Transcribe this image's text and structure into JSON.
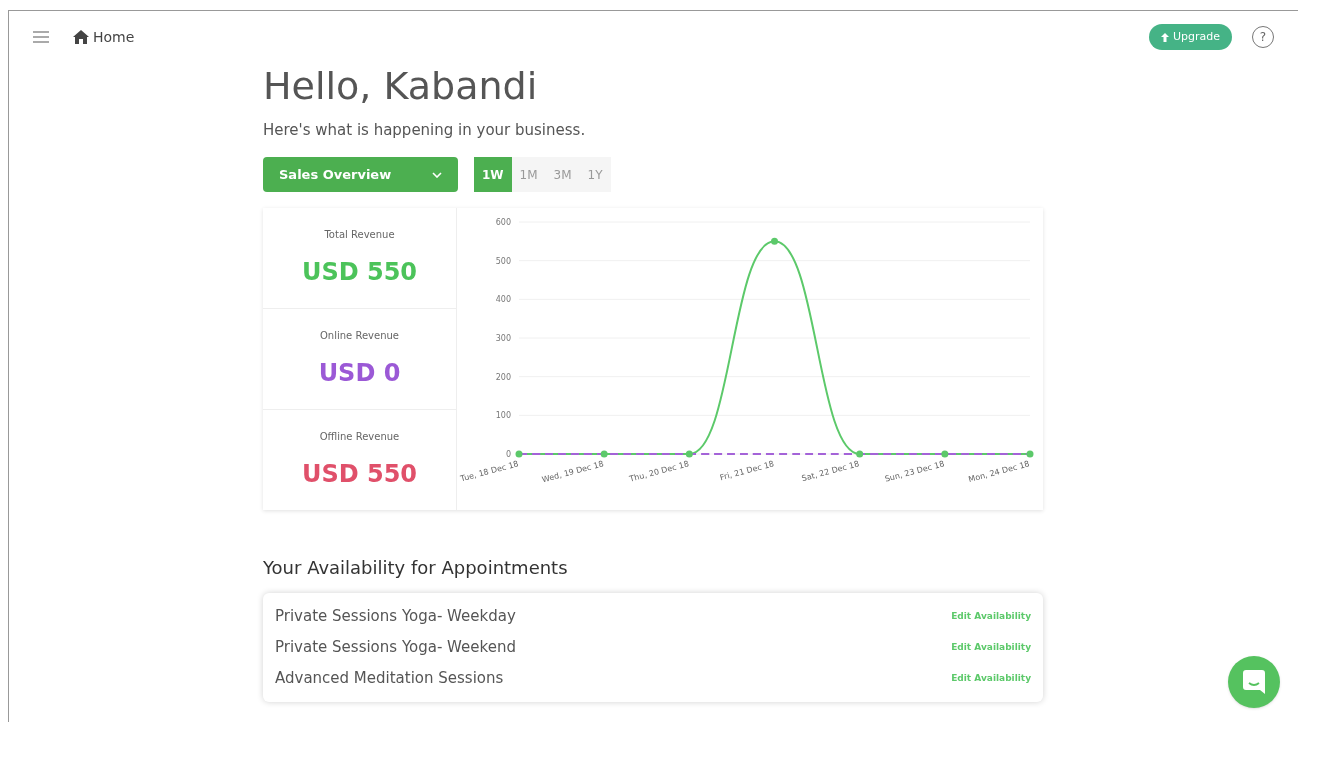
{
  "header": {
    "breadcrumb": "Home",
    "upgrade": "Upgrade",
    "help": "?"
  },
  "greeting": "Hello, Kabandi",
  "subtitle": "Here's what is happening in your business.",
  "overview_select": "Sales Overview",
  "ranges": [
    {
      "label": "1W",
      "selected": true
    },
    {
      "label": "1M",
      "selected": false
    },
    {
      "label": "3M",
      "selected": false
    },
    {
      "label": "1Y",
      "selected": false
    }
  ],
  "stats": [
    {
      "label": "Total Revenue",
      "value": "USD 550",
      "color": "#4cc35a"
    },
    {
      "label": "Online Revenue",
      "value": "USD 0",
      "color": "#9b59d6"
    },
    {
      "label": "Offline Revenue",
      "value": "USD 550",
      "color": "#e0506a"
    }
  ],
  "chart_data": {
    "type": "line",
    "grid": true,
    "categories": [
      "Tue, 18 Dec 18",
      "Wed, 19 Dec 18",
      "Thu, 20 Dec 18",
      "Fri, 21 Dec 18",
      "Sat, 22 Dec 18",
      "Sun, 23 Dec 18",
      "Mon, 24 Dec 18"
    ],
    "ylim": [
      0,
      600
    ],
    "yticks": [
      0,
      100,
      200,
      300,
      400,
      500,
      600
    ],
    "series": [
      {
        "color": "#5cc96a",
        "marker": true,
        "line_style": "solid",
        "values": [
          0,
          0,
          0,
          550,
          0,
          0,
          0
        ]
      },
      {
        "color": "#a463d8",
        "marker": false,
        "line_style": "dashed",
        "values": [
          0,
          0,
          0,
          0,
          0,
          0,
          0
        ]
      }
    ]
  },
  "availability": {
    "title": "Your Availability for Appointments",
    "items": [
      {
        "name": "Private Sessions Yoga- Weekday",
        "action": "Edit Availability"
      },
      {
        "name": "Private Sessions Yoga- Weekend",
        "action": "Edit Availability"
      },
      {
        "name": "Advanced Meditation Sessions",
        "action": "Edit Availability"
      }
    ]
  }
}
